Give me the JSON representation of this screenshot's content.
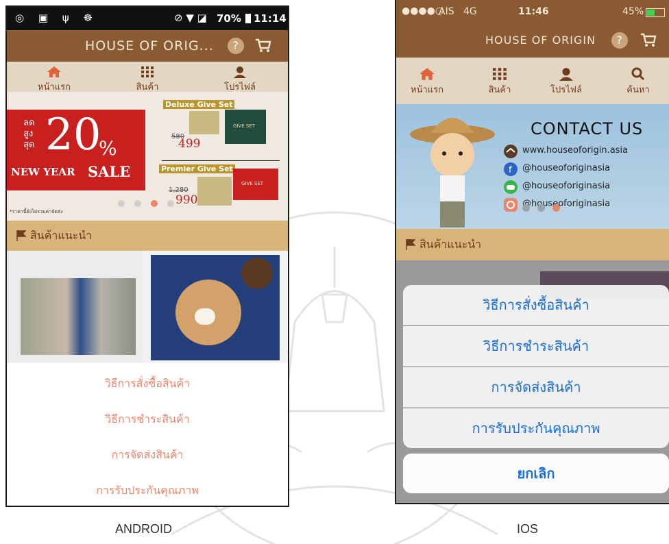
{
  "android": {
    "status": {
      "percent": "70%",
      "time": "11:14"
    },
    "title": "HOUSE OF ORIG...",
    "tabs": [
      "หน้าแรก",
      "สินค้า",
      "โปรไฟล์"
    ],
    "banner": {
      "discount_prefix": [
        "ลด",
        "สูง",
        "สุด"
      ],
      "discount": "20",
      "percent_sign": "%",
      "new_year": "NEW YEAR",
      "sale": "SALE",
      "deluxe_title": "Deluxe Give Set",
      "deluxe_old_price": "580",
      "deluxe_price": "499",
      "premier_title": "Premier Give Set",
      "premier_old_price": "1,280",
      "premier_price": "990",
      "give_set": "GIVE SET",
      "note": "*ราคานี้ยังไม่รวมค่าจัดส่ง"
    },
    "section_title": "สินค้าแนะนำ",
    "menu": [
      "วิธีการสั่งซื้อสินค้า",
      "วิธีการชำระสินค้า",
      "การจัดส่งสินค้า",
      "การรับประกันคุณภาพ"
    ]
  },
  "ios": {
    "status": {
      "carrier": "AIS",
      "network": "4G",
      "time": "11:46",
      "battery": "45%"
    },
    "title": "HOUSE OF ORIGIN",
    "tabs": [
      "หน้าแรก",
      "สินค้า",
      "โปรไฟล์",
      "ค้นหา"
    ],
    "banner": {
      "heading": "CONTACT US",
      "website": "www.houseoforigin.asia",
      "facebook": "@houseoforiginasia",
      "line": "@houseoforiginasia",
      "instagram": "@houseoforiginasia"
    },
    "section_title": "สินค้าแนะนำ",
    "menu": [
      "วิธีการสั่งซื้อสินค้า",
      "วิธีการชำระสินค้า",
      "การจัดส่งสินค้า",
      "การรับประกันคุณภาพ"
    ],
    "cancel": "ยกเลิก"
  },
  "captions": {
    "android": "ANDROID",
    "ios": "IOS"
  },
  "colors": {
    "header_brown": "#8a5a33",
    "tab_beige": "#e3d6c3",
    "section_gold": "#d9b47a",
    "menu_orange": "#e9856b",
    "ios_blue": "#1a6ed8",
    "sale_red": "#c8201e"
  }
}
